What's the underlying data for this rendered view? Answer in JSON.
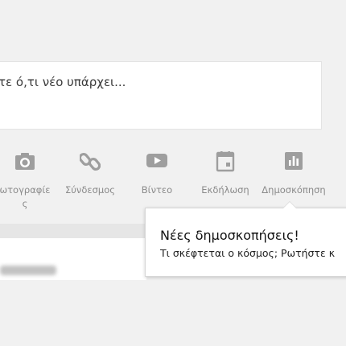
{
  "composer": {
    "placeholder_text": "τε ό,τι νέο υπάρχει..."
  },
  "actions": [
    {
      "id": "photo",
      "label": "ωτογραφίε\nς",
      "icon": "camera-icon"
    },
    {
      "id": "link",
      "label": "Σύνδεσμος",
      "icon": "link-icon"
    },
    {
      "id": "video",
      "label": "Βίντεο",
      "icon": "video-play-icon"
    },
    {
      "id": "event",
      "label": "Εκδήλωση",
      "icon": "calendar-icon"
    },
    {
      "id": "poll",
      "label": "Δημοσκόπηση",
      "icon": "poll-chart-icon"
    }
  ],
  "tooltip": {
    "title": "Νέες δημοσκοπήσεις!",
    "body": "Τι σκέφτεται ο κόσμος; Ρωτήστε κ"
  },
  "colors": {
    "icon_gray": "#9e9e9e",
    "label_gray": "#8a8a8a",
    "background": "#f1f1f1"
  }
}
